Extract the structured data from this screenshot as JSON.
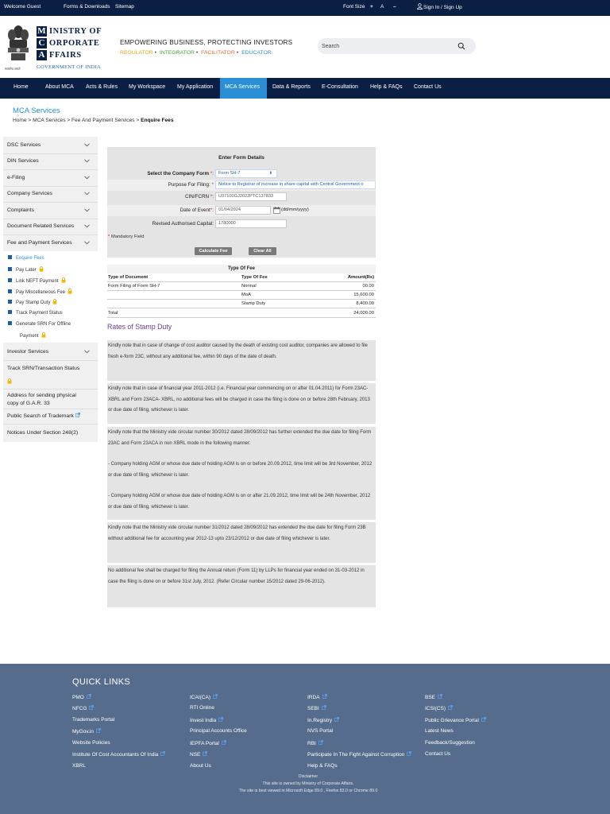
{
  "topbar": {
    "welcome": "Welcome Guest",
    "forms_downloads": "Forms & Downloads",
    "sitemap": "Sitemap",
    "font_size": "Font Size",
    "font_plus": "+",
    "font_a": "A",
    "font_minus": "–",
    "sign_in": "Sign In / Sign Up"
  },
  "header": {
    "logo_letters": [
      "M",
      "C",
      "A"
    ],
    "logo_words": [
      "INISTRY OF",
      "ORPORATE",
      "FFAIRS"
    ],
    "gov": "GOVERNMENT OF INDIA",
    "emblem_caption": "सत्यमेव जयते",
    "tagline": "EMPOWERING BUSINESS, PROTECTING INVESTORS",
    "roles": [
      {
        "label": "REGULATOR",
        "color": "#e8a317"
      },
      {
        "label": "INTEGRATOR",
        "color": "#49a833"
      },
      {
        "label": "FACILITATOR",
        "color": "#e06c2a"
      },
      {
        "label": "EDUCATOR",
        "color": "#2b8fd6"
      }
    ],
    "search_placeholder": "Search"
  },
  "nav": {
    "items": [
      "Home",
      "About MCA",
      "Acts & Rules",
      "My Workspace",
      "My Application",
      "MCA Services",
      "Data & Reports",
      "E-Consultation",
      "Help & FAQs",
      "Contact Us"
    ],
    "active_index": 5
  },
  "page": {
    "heading": "MCA Services",
    "breadcrumb_prefix": "Home > MCA Services > Fee And Payment Services > ",
    "breadcrumb_current": "Enquire Fees"
  },
  "sidebar": {
    "items": [
      "DSC Services",
      "DIN Services",
      "e-Filing",
      "Company Services",
      "Complaints",
      "Document Related Services",
      "Fee and Payment Services"
    ],
    "sub_items": [
      "Enquire Fees",
      "Pay Later",
      "Link NEFT Payment",
      "Pay Miscellaneous Fee",
      "Pay Stamp Duty",
      "Track Payment Status",
      "Generate SRN For Offline",
      "Payment"
    ],
    "investor_services": "Investor Services",
    "track_srn": "Track SRN/Transaction Status",
    "address_line1": "Address for sending physical",
    "address_line2": "copy of G.A.R. 33",
    "public_search": "Public Search of Trademark",
    "notices": "Notices Under Section 248(2)"
  },
  "form": {
    "title": "Enter Form Details",
    "company_form_label": "Select the Company Form",
    "company_form_value": "Form SH-7",
    "purpose_label": "Purpose For Filing:",
    "purpose_value": "Notice to Registrar of increase in share capital with Central Government o",
    "cin_label": "CIN/FCRN",
    "cin_value": "U37100GJ2022PTC137833",
    "date_label": "Date of Event",
    "date_value": "01/04/2024",
    "date_hint": "(dd/mm/yyyy)",
    "capital_label": "Revised Authorised Capital:",
    "capital_value": "1780000",
    "mandatory": "Mandatory Field",
    "calculate_label": "Calculate Fee",
    "clear_label": "Clear All"
  },
  "fee_table": {
    "title": "Type Of Fee",
    "headers": [
      "Type of Document",
      "Type Of Fee",
      "Amount(Rs)"
    ],
    "rows": [
      [
        "Form Filing of  Form SH-7",
        "Normal",
        "00.00"
      ],
      [
        "",
        "MoA",
        "15,600.00"
      ],
      [
        "",
        "Stamp Duty",
        "8,400.00"
      ],
      [
        "Total",
        "",
        "24,000.00"
      ]
    ]
  },
  "stamp_duty": {
    "heading": "Rates of Stamp Duty",
    "notes": [
      "Kindly note that in case of change of cost auditor caused by the death of existing cost auditor, companies are allowed to file fresh e-form 23C, without any additional fee, within 90 days of the date of death.",
      "Kindly note that in case of financial year 2011-2012 (i.e. Financial year commencing on or after 01.04.2011) for Form 23AC-XBRL and Form 23ACA- XBRL, no additional fees will be charged in case the filing is done on or before 28th February, 2013 or due date of filing, whichever is later.",
      "Kindly note that the Ministry vide circular number 30/2012 dated 28/09/2012 has further extended the due date for filing Form 23AC and Form 23ACA in non XBRL mode in the following manner:",
      "- Company holding AGM or whose due date of holding AGM is on or before 20.09.2012, time limit will be 3rd November, 2012 or due date of filing, whichever is later.",
      "- Company holding AGM or whose due date of holding AGM is on or after 21.09.2012, time limit will be 24th November, 2012 or due date of filing, whichever is later.",
      "Kindly note that the Ministry vide circular number 31/2012 dated 28/09/2012 has extended the due date for filing Form 23B without additional fee for accounting year 2012-13 upto 23/12/2012 or due date of filing whichever is later.",
      "No additional fee shall be charged for filing the Annual return (Form 11) by LLPs for financial year ended on 31-03-2012 in case the filing is done on or before 31st July, 2012. (Refer Circular number 15/2012 dated 29-06-2012)."
    ]
  },
  "footer": {
    "quick_links_title": "QUICK LINKS",
    "columns": [
      [
        "PMO",
        "NFCG",
        "Trademarks Portal",
        "MyGov.in",
        "Website Policies",
        "Institute Of Cost Accountants Of India",
        "XBRL"
      ],
      [
        "ICAI(CA)",
        "RTI Online",
        "Invest India",
        "Principal Accounts Office",
        "IEPFA Portal",
        "NSE",
        "About Us"
      ],
      [
        "IRDA",
        "SEBI",
        "In.Registry",
        "NVS Portal",
        "RBI",
        "Participate In The Fight Against Corruption",
        "Help & FAQs"
      ],
      [
        "BSE",
        "ICSI(CS)",
        "Public Grievance Portal",
        "Latest News",
        "Feedback/Suggestion",
        "Contact Us"
      ]
    ],
    "disclaimer": "Disclaimer",
    "owned": "This site is owned by Ministry of Corporate Affairs.",
    "best_viewed": "The site is best viewed in Microsoft Edge 89.0 , Firefox 83.0 or Chrome 89.0"
  },
  "colors": {
    "navy": "#0b1f45",
    "active_tab": "#2b8fd6",
    "footer_bg": "#566c8c",
    "stamp_heading": "#6b3d9a"
  }
}
